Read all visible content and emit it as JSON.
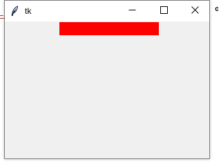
{
  "window": {
    "title": "tk",
    "icon": "feather-icon",
    "controls": [
      "minimize-icon",
      "maximize-icon",
      "close-icon"
    ],
    "background_color": "#f0f0f0",
    "titlebar_color": "#ffffff"
  },
  "canvas": {
    "bar_color": "#ff0000"
  },
  "background": {
    "right_edge_glyph": "o"
  }
}
